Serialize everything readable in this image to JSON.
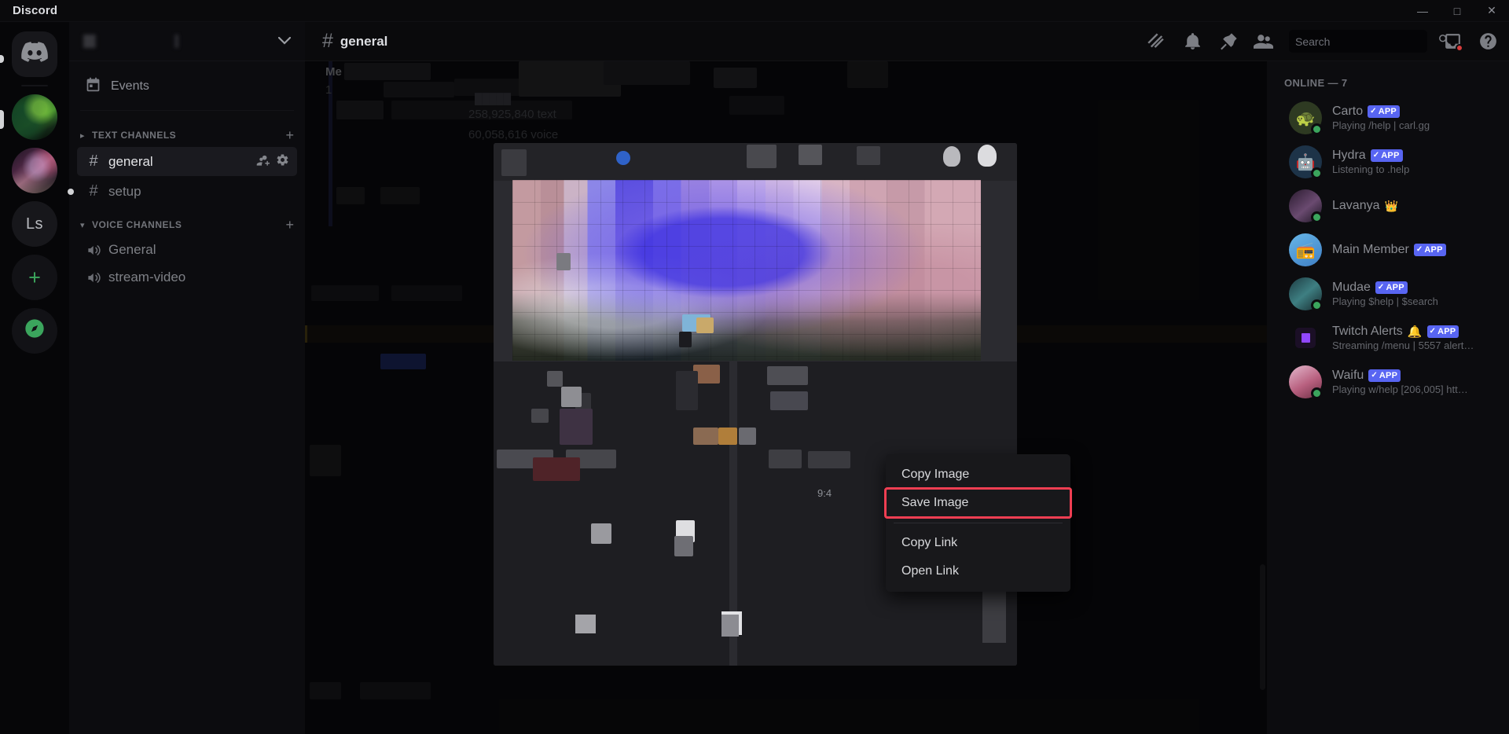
{
  "window": {
    "brand": "Discord",
    "minimize": "—",
    "maximize": "□",
    "close": "✕"
  },
  "server_rail": {
    "items": [
      {
        "name": "home",
        "label": "",
        "type": "discord-home"
      },
      {
        "name": "nature-server",
        "label": "",
        "type": "image"
      },
      {
        "name": "anime-server",
        "label": "",
        "type": "image"
      },
      {
        "name": "ls-server",
        "label": "Ls",
        "type": "text"
      },
      {
        "name": "add-server",
        "label": "+",
        "type": "action"
      },
      {
        "name": "explore-servers",
        "label": "",
        "type": "compass"
      }
    ]
  },
  "sidebar": {
    "server_name": "",
    "events_label": "Events",
    "categories": [
      {
        "label": "Text Channels",
        "collapsed": true,
        "channels": [
          {
            "name": "general",
            "active": true,
            "unread": false
          },
          {
            "name": "setup",
            "active": false,
            "unread": true
          }
        ]
      },
      {
        "label": "Voice Channels",
        "collapsed": false,
        "channels": [
          {
            "name": "General",
            "active": false,
            "unread": false
          },
          {
            "name": "stream-video",
            "active": false,
            "unread": false
          }
        ]
      }
    ]
  },
  "chat_header": {
    "hash": "#",
    "channel": "general",
    "icons": [
      "threads-icon",
      "bell-icon",
      "pin-icon",
      "members-icon"
    ],
    "search_placeholder": "Search",
    "search_value": "",
    "inbox_icon": "inbox-icon",
    "help_icon": "help-icon"
  },
  "chat_body": {
    "member_label": "Me",
    "member_count": "1",
    "stats_text": "258,925,840 text",
    "stats_voice": "60,058,616 voice",
    "timestamp": "9:4"
  },
  "context_menu": {
    "items": [
      {
        "label": "Copy Image",
        "selected": false
      },
      {
        "label": "Save Image",
        "selected": true
      },
      {
        "label": "Copy Link",
        "selected": false
      },
      {
        "label": "Open Link",
        "selected": false
      }
    ],
    "divider_after_index": 1,
    "highlight_color": "#ef3e52"
  },
  "members": {
    "header": "ONLINE — 7",
    "list": [
      {
        "name": "Carto",
        "badge": "APP",
        "status": "Playing /help | carl.gg",
        "avatar": "a-carto",
        "emoji": "🐢",
        "online": true,
        "crown": false,
        "bell": false
      },
      {
        "name": "Hydra",
        "badge": "APP",
        "status": "Listening to .help",
        "avatar": "a-hydra",
        "emoji": "🤖",
        "online": true,
        "crown": false,
        "bell": false
      },
      {
        "name": "Lavanya",
        "badge": "",
        "status": "",
        "avatar": "a-lav",
        "emoji": "",
        "online": true,
        "crown": true,
        "bell": false
      },
      {
        "name": "Main Member",
        "badge": "APP",
        "status": "",
        "avatar": "a-main",
        "emoji": "📻",
        "online": false,
        "crown": false,
        "bell": false
      },
      {
        "name": "Mudae",
        "badge": "APP",
        "status": "Playing $help | $search",
        "avatar": "a-mudae",
        "emoji": "",
        "online": true,
        "crown": false,
        "bell": false
      },
      {
        "name": "Twitch Alerts",
        "badge": "APP",
        "status": "Streaming /menu | 5557 alert…",
        "avatar": "a-twitch",
        "emoji": "",
        "online": false,
        "crown": false,
        "bell": true
      },
      {
        "name": "Waifu",
        "badge": "APP",
        "status": "Playing w/help [206,005] htt…",
        "avatar": "a-waifu",
        "emoji": "",
        "online": true,
        "crown": false,
        "bell": false
      }
    ]
  },
  "colors": {
    "brand_blurple": "#5865f2",
    "online_green": "#3ba55d",
    "highlight_red": "#ef3e52",
    "app_bg": "#0a0a0c"
  }
}
